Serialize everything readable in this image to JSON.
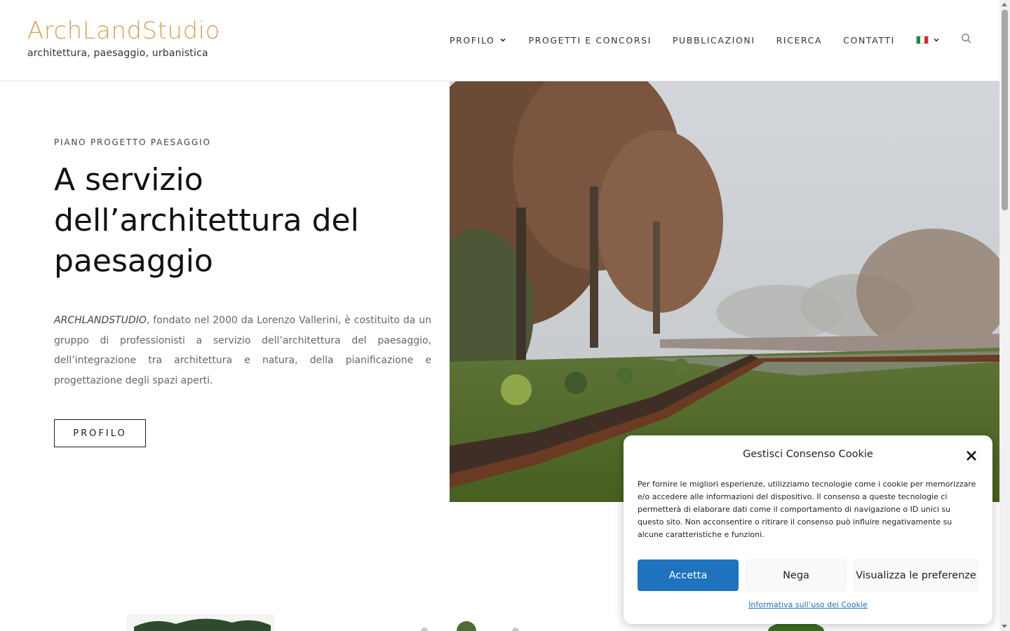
{
  "brand": {
    "name": "ArchLandStudio",
    "tagline": "architettura, paesaggio, urbanistica",
    "accent_color": "#d4a25a"
  },
  "nav": {
    "items": [
      {
        "label": "PROFILO",
        "has_dropdown": true
      },
      {
        "label": "PROGETTI E CONCORSI",
        "has_dropdown": false
      },
      {
        "label": "PUBBLICAZIONI",
        "has_dropdown": false
      },
      {
        "label": "RICERCA",
        "has_dropdown": false
      },
      {
        "label": "CONTATTI",
        "has_dropdown": false
      }
    ],
    "language_icon": "italian-flag-icon",
    "search_icon": "search-icon"
  },
  "hero": {
    "eyebrow": "PIANO PROGETTO PAESAGGIO",
    "title": "A servizio dell’architettura del paesaggio",
    "body_lead": "ARCHLANDSTUDIO",
    "body_rest": ", fondato nel 2000 da Lorenzo Vallerini, è costituito da un gruppo di professionisti a servizio dell’architettura del paesaggio, dell’integrazione tra architettura e natura, della pianificazione e progettazione degli spazi aperti.",
    "button_label": "PROFILO"
  },
  "cookie": {
    "title": "Gestisci Consenso Cookie",
    "text": "Per fornire le migliori esperienze, utilizziamo tecnologie come i cookie per memorizzare e/o accedere alle informazioni del dispositivo. Il consenso a queste tecnologie ci permetterà di elaborare dati come il comportamento di navigazione o ID unici su questo sito. Non acconsentire o ritirare il consenso può influire negativamente su alcune caratteristiche e funzioni.",
    "accept_label": "Accetta",
    "deny_label": "Nega",
    "prefs_label": "Visualizza le preferenze",
    "policy_link": "Informativa sull’uso dei Cookie",
    "accept_color": "#1e73be"
  }
}
